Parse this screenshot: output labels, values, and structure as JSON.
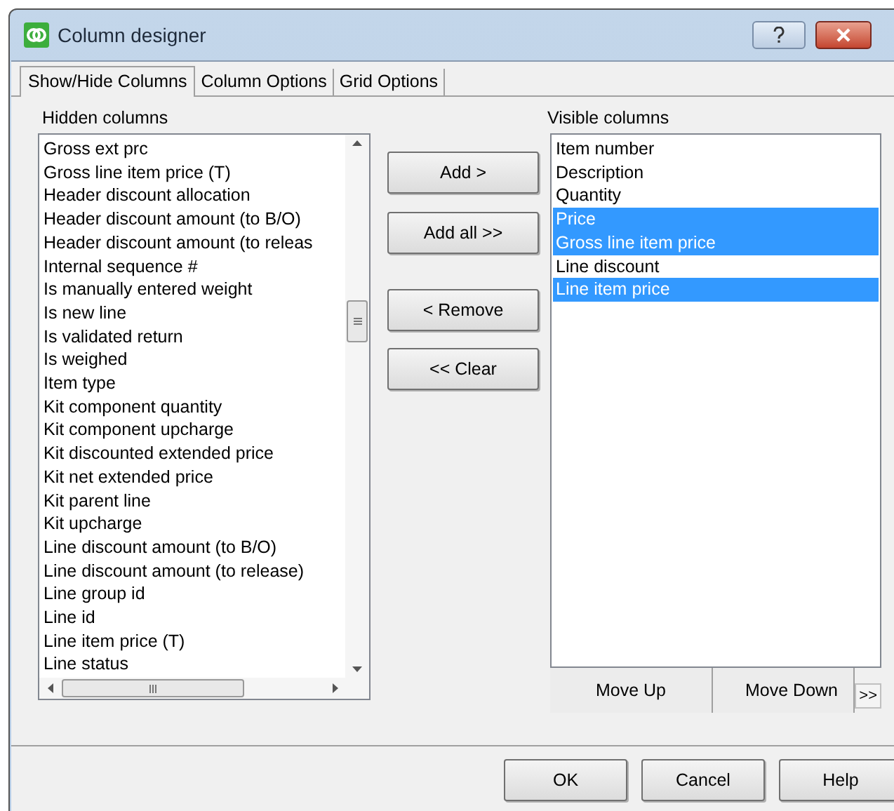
{
  "window": {
    "title": "Column designer"
  },
  "tabs": [
    {
      "label": "Show/Hide Columns",
      "selected": true
    },
    {
      "label": "Column Options",
      "selected": false
    },
    {
      "label": "Grid Options",
      "selected": false
    }
  ],
  "hidden_columns": {
    "label": "Hidden columns",
    "items": [
      "Gross ext prc",
      "Gross line item price (T)",
      "Header discount allocation",
      "Header discount amount (to B/O)",
      "Header discount amount (to releas",
      "Internal sequence #",
      "Is manually entered weight",
      "Is new line",
      "Is validated return",
      "Is weighed",
      "Item type",
      "Kit component quantity",
      "Kit component upcharge",
      "Kit discounted extended price",
      "Kit net extended price",
      "Kit parent line",
      "Kit upcharge",
      "Line discount amount (to B/O)",
      "Line discount amount (to release)",
      "Line group id",
      "Line id",
      "Line item price (T)",
      "Line status"
    ]
  },
  "transfer_buttons": [
    "Add >",
    "Add all >>",
    "< Remove",
    "<< Clear"
  ],
  "visible_columns": {
    "label": "Visible columns",
    "items": [
      {
        "label": "Item number",
        "selected": false
      },
      {
        "label": "Description",
        "selected": false
      },
      {
        "label": "Quantity",
        "selected": false
      },
      {
        "label": "Price",
        "selected": true
      },
      {
        "label": "Gross line item price",
        "selected": true
      },
      {
        "label": "Line discount",
        "selected": false
      },
      {
        "label": "Line item price",
        "selected": true
      }
    ]
  },
  "order_buttons": [
    "Move Up",
    "Move Down"
  ],
  "overflow_button": ">>",
  "dialog_buttons": [
    "OK",
    "Cancel",
    "Help"
  ]
}
